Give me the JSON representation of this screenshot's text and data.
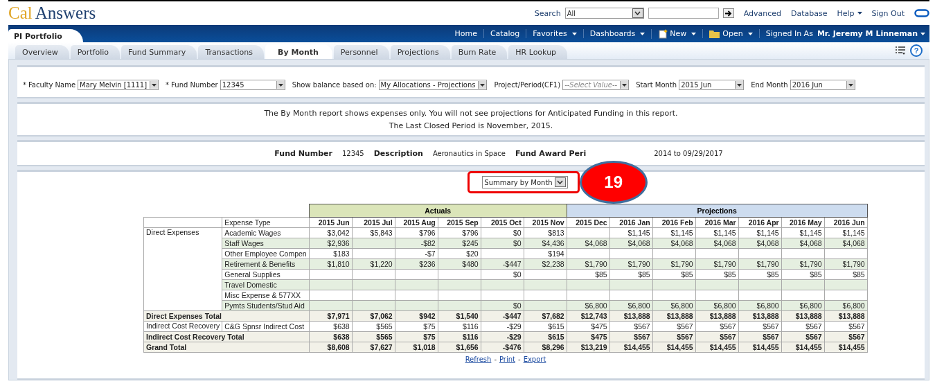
{
  "app": {
    "logo_first": "Cal",
    "logo_second": "Answers"
  },
  "top_links": {
    "search_label": "Search",
    "search_scope": "All",
    "links": [
      {
        "label": "Advanced",
        "menu": false
      },
      {
        "label": "Database",
        "menu": false
      },
      {
        "label": "Help",
        "menu": true
      },
      {
        "label": "Sign Out",
        "menu": false
      }
    ]
  },
  "nav": {
    "portfolio_tab": "PI Portfolio",
    "items": [
      {
        "label": "Home",
        "kind": "plain"
      },
      {
        "label": "Catalog",
        "kind": "plain"
      },
      {
        "label": "Favorites",
        "kind": "menu"
      },
      {
        "label": "Dashboards",
        "kind": "menu"
      },
      {
        "label": "New",
        "kind": "new"
      },
      {
        "label": "Open",
        "kind": "open"
      }
    ],
    "signed_in_label": "Signed In As",
    "user": "Mr. Jeremy M Linneman"
  },
  "tabs": [
    {
      "label": "Overview",
      "selected": false
    },
    {
      "label": "Portfolio",
      "selected": false
    },
    {
      "label": "Fund Summary",
      "selected": false
    },
    {
      "label": "Transactions",
      "selected": false
    },
    {
      "label": "By Month",
      "selected": true
    },
    {
      "label": "Personnel",
      "selected": false
    },
    {
      "label": "Projections",
      "selected": false
    },
    {
      "label": "Burn Rate",
      "selected": false
    },
    {
      "label": "HR Lookup",
      "selected": false
    }
  ],
  "help_glyph": "?",
  "required_mark": "*",
  "filters": [
    {
      "label": "Faculty Name",
      "required": true,
      "value": "Mary Melvin [1111]"
    },
    {
      "label": "Fund Number",
      "required": true,
      "value": "12345"
    },
    {
      "label": "Show balance based on:",
      "required": false,
      "value": "My Allocations - Projections"
    },
    {
      "label": "Project/Period(CF1)",
      "required": false,
      "placeholder": "--Select Value--"
    },
    {
      "label": "Start Month",
      "required": false,
      "value": "2015 Jun"
    },
    {
      "label": "End Month",
      "required": false,
      "value": "2016 Jun"
    }
  ],
  "messages": [
    "The By Month report shows expenses only. You will not see projections for Anticipated Funding in this report.",
    "The Last Closed Period is November, 2015."
  ],
  "fund_info": {
    "fund_number_label": "Fund Number",
    "fund_number": "12345",
    "description_label": "Description",
    "description": "Aeronautics in Space",
    "period_label": "Fund Award Peri",
    "period_value": "2014  to  09/29/2017"
  },
  "view_selector": "Summary by Month",
  "callout": "19",
  "table": {
    "type_header": "Expense Type",
    "groups": [
      {
        "label": "Actuals",
        "months": [
          "2015 Jun",
          "2015 Jul",
          "2015 Aug",
          "2015 Sep",
          "2015 Oct",
          "2015 Nov"
        ]
      },
      {
        "label": "Projections",
        "months": [
          "2015 Dec",
          "2016 Jan",
          "2016 Feb",
          "2016 Mar",
          "2016 Apr",
          "2016 May",
          "2016 Jun"
        ]
      }
    ],
    "sections": [
      {
        "category": "Direct Expenses",
        "rows": [
          {
            "type": "Academic Wages",
            "cells": [
              {
                "amount": "$3,042"
              },
              {
                "amount": "$5,843"
              },
              {
                "amount": "$796"
              },
              {
                "amount": "$796"
              },
              {
                "amount": "$0"
              },
              {
                "amount": "$813"
              },
              {},
              {
                "amount": "$1,145"
              },
              {
                "amount": "$1,145"
              },
              {
                "amount": "$1,145"
              },
              {
                "amount": "$1,145"
              },
              {
                "amount": "$1,145"
              },
              {
                "amount": "$1,145"
              }
            ]
          },
          {
            "type": "Staff Wages",
            "cells": [
              {
                "amount": "$2,936"
              },
              {},
              {
                "amount": "-$82"
              },
              {
                "amount": "$245"
              },
              {
                "amount": "$0"
              },
              {
                "amount": "$4,436"
              },
              {
                "amount": "$4,068"
              },
              {
                "amount": "$4,068"
              },
              {
                "amount": "$4,068"
              },
              {
                "amount": "$4,068"
              },
              {
                "amount": "$4,068"
              },
              {
                "amount": "$4,068"
              },
              {
                "amount": "$4,068"
              }
            ]
          },
          {
            "type": "Other Employee Compen",
            "cells": [
              {
                "amount": "$183"
              },
              {},
              {
                "amount": "-$7"
              },
              {
                "amount": "$20"
              },
              {},
              {
                "amount": "$194"
              },
              {},
              {},
              {},
              {},
              {},
              {},
              {}
            ]
          },
          {
            "type": "Retirement & Benefits",
            "cells": [
              {
                "amount": "$1,810"
              },
              {
                "amount": "$1,220"
              },
              {
                "amount": "$236"
              },
              {
                "amount": "$480"
              },
              {
                "amount": "-$447"
              },
              {
                "amount": "$2,238"
              },
              {
                "amount": "$1,790"
              },
              {
                "amount": "$1,790"
              },
              {
                "amount": "$1,790"
              },
              {
                "amount": "$1,790"
              },
              {
                "amount": "$1,790"
              },
              {
                "amount": "$1,790"
              },
              {
                "amount": "$1,790"
              }
            ]
          },
          {
            "type": "General Supplies",
            "cells": [
              {},
              {},
              {},
              {},
              {
                "amount": "$0"
              },
              {},
              {
                "amount": "$85"
              },
              {
                "amount": "$85"
              },
              {
                "amount": "$85"
              },
              {
                "amount": "$85"
              },
              {
                "amount": "$85"
              },
              {
                "amount": "$85"
              },
              {
                "amount": "$85"
              }
            ]
          },
          {
            "type": "Travel Domestic",
            "cells": [
              {},
              {},
              {},
              {},
              {},
              {},
              {},
              {},
              {},
              {},
              {},
              {},
              {}
            ]
          },
          {
            "type": "Misc Expense & 577XX",
            "cells": [
              {},
              {},
              {},
              {},
              {},
              {},
              {},
              {},
              {},
              {},
              {},
              {},
              {}
            ]
          },
          {
            "type": "Pymts Students/Stud Aid",
            "cells": [
              {},
              {},
              {},
              {},
              {
                "amount": "$0"
              },
              {},
              {
                "amount": "$6,800"
              },
              {
                "amount": "$6,800"
              },
              {
                "amount": "$6,800"
              },
              {
                "amount": "$6,800"
              },
              {
                "amount": "$6,800"
              },
              {
                "amount": "$6,800"
              },
              {
                "amount": "$6,800"
              }
            ]
          }
        ],
        "total": {
          "label": "Direct Expenses Total",
          "values": [
            "$7,971",
            "$7,062",
            "$942",
            "$1,540",
            "-$447",
            "$7,682",
            "$12,743",
            "$13,888",
            "$13,888",
            "$13,888",
            "$13,888",
            "$13,888",
            "$13,888"
          ]
        }
      },
      {
        "category": "Indirect Cost Recovery",
        "rows": [
          {
            "type": "C&G Spnsr Indirect Cost",
            "cells": [
              {
                "amount": "$638"
              },
              {
                "amount": "$565"
              },
              {
                "amount": "$75"
              },
              {
                "amount": "$116"
              },
              {
                "amount": "-$29"
              },
              {
                "amount": "$615"
              },
              {
                "amount": "$475"
              },
              {
                "amount": "$567"
              },
              {
                "amount": "$567"
              },
              {
                "amount": "$567"
              },
              {
                "amount": "$567"
              },
              {
                "amount": "$567"
              },
              {
                "amount": "$567"
              }
            ]
          }
        ],
        "total": {
          "label": "Indirect Cost Recovery Total",
          "values": [
            "$638",
            "$565",
            "$75",
            "$116",
            "-$29",
            "$615",
            "$475",
            "$567",
            "$567",
            "$567",
            "$567",
            "$567",
            "$567"
          ]
        }
      }
    ],
    "grand_total": {
      "label": "Grand Total",
      "values": [
        "$8,608",
        "$7,627",
        "$1,018",
        "$1,656",
        "-$476",
        "$8,296",
        "$13,219",
        "$14,455",
        "$14,455",
        "$14,455",
        "$14,455",
        "$14,455",
        "$14,455"
      ]
    }
  },
  "footer_links": [
    "Refresh",
    "Print",
    "Export"
  ],
  "footer_separator": "-"
}
